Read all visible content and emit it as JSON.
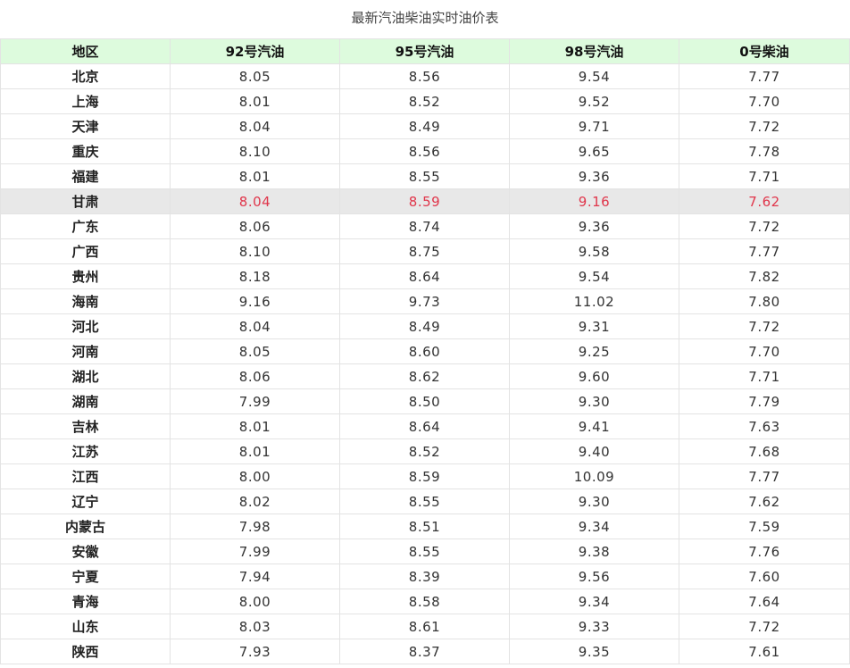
{
  "title": "最新汽油柴油实时油价表",
  "headers": [
    "地区",
    "92号汽油",
    "95号汽油",
    "98号汽油",
    "0号柴油"
  ],
  "highlight_color": "#e0364b",
  "header_bg": "#ddfbdd",
  "rows": [
    {
      "region": "北京",
      "p92": "8.05",
      "p95": "8.56",
      "p98": "9.54",
      "p0": "7.77",
      "highlight": false
    },
    {
      "region": "上海",
      "p92": "8.01",
      "p95": "8.52",
      "p98": "9.52",
      "p0": "7.70",
      "highlight": false
    },
    {
      "region": "天津",
      "p92": "8.04",
      "p95": "8.49",
      "p98": "9.71",
      "p0": "7.72",
      "highlight": false
    },
    {
      "region": "重庆",
      "p92": "8.10",
      "p95": "8.56",
      "p98": "9.65",
      "p0": "7.78",
      "highlight": false
    },
    {
      "region": "福建",
      "p92": "8.01",
      "p95": "8.55",
      "p98": "9.36",
      "p0": "7.71",
      "highlight": false
    },
    {
      "region": "甘肃",
      "p92": "8.04",
      "p95": "8.59",
      "p98": "9.16",
      "p0": "7.62",
      "highlight": true
    },
    {
      "region": "广东",
      "p92": "8.06",
      "p95": "8.74",
      "p98": "9.36",
      "p0": "7.72",
      "highlight": false
    },
    {
      "region": "广西",
      "p92": "8.10",
      "p95": "8.75",
      "p98": "9.58",
      "p0": "7.77",
      "highlight": false
    },
    {
      "region": "贵州",
      "p92": "8.18",
      "p95": "8.64",
      "p98": "9.54",
      "p0": "7.82",
      "highlight": false
    },
    {
      "region": "海南",
      "p92": "9.16",
      "p95": "9.73",
      "p98": "11.02",
      "p0": "7.80",
      "highlight": false
    },
    {
      "region": "河北",
      "p92": "8.04",
      "p95": "8.49",
      "p98": "9.31",
      "p0": "7.72",
      "highlight": false
    },
    {
      "region": "河南",
      "p92": "8.05",
      "p95": "8.60",
      "p98": "9.25",
      "p0": "7.70",
      "highlight": false
    },
    {
      "region": "湖北",
      "p92": "8.06",
      "p95": "8.62",
      "p98": "9.60",
      "p0": "7.71",
      "highlight": false
    },
    {
      "region": "湖南",
      "p92": "7.99",
      "p95": "8.50",
      "p98": "9.30",
      "p0": "7.79",
      "highlight": false
    },
    {
      "region": "吉林",
      "p92": "8.01",
      "p95": "8.64",
      "p98": "9.41",
      "p0": "7.63",
      "highlight": false
    },
    {
      "region": "江苏",
      "p92": "8.01",
      "p95": "8.52",
      "p98": "9.40",
      "p0": "7.68",
      "highlight": false
    },
    {
      "region": "江西",
      "p92": "8.00",
      "p95": "8.59",
      "p98": "10.09",
      "p0": "7.77",
      "highlight": false
    },
    {
      "region": "辽宁",
      "p92": "8.02",
      "p95": "8.55",
      "p98": "9.30",
      "p0": "7.62",
      "highlight": false
    },
    {
      "region": "内蒙古",
      "p92": "7.98",
      "p95": "8.51",
      "p98": "9.34",
      "p0": "7.59",
      "highlight": false
    },
    {
      "region": "安徽",
      "p92": "7.99",
      "p95": "8.55",
      "p98": "9.38",
      "p0": "7.76",
      "highlight": false
    },
    {
      "region": "宁夏",
      "p92": "7.94",
      "p95": "8.39",
      "p98": "9.56",
      "p0": "7.60",
      "highlight": false
    },
    {
      "region": "青海",
      "p92": "8.00",
      "p95": "8.58",
      "p98": "9.34",
      "p0": "7.64",
      "highlight": false
    },
    {
      "region": "山东",
      "p92": "8.03",
      "p95": "8.61",
      "p98": "9.33",
      "p0": "7.72",
      "highlight": false
    },
    {
      "region": "陕西",
      "p92": "7.93",
      "p95": "8.37",
      "p98": "9.35",
      "p0": "7.61",
      "highlight": false
    }
  ]
}
